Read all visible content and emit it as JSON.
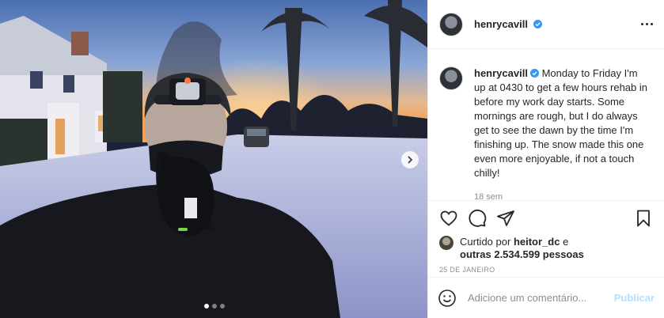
{
  "post": {
    "username": "henrycavill",
    "caption_text": "Monday to Friday I'm up at 0430 to get a few hours rehab in before my work day starts. Some mornings are rough, but I do always get to see the dawn by the time I'm finishing up. The snow made this one even more enjoyable, if not a touch chilly!",
    "caption_age": "18 sem",
    "liked_by_prefix": "Curtido por",
    "liked_by_user": "heitor_dc",
    "liked_by_and": "e",
    "liked_by_others": "outras 2.534.599 pessoas",
    "date": "25 DE JANEIRO",
    "carousel_total": 3,
    "carousel_active": 1
  },
  "comment": {
    "placeholder": "Adicione um comentário...",
    "publish_label": "Publicar"
  },
  "colors": {
    "verified": "#3897f0",
    "publish_disabled": "#b2dffc",
    "meta_gray": "#8e8e8e"
  },
  "icons": [
    "verified-badge-icon",
    "more-options-icon",
    "heart-icon",
    "comment-icon",
    "share-icon",
    "save-icon",
    "emoji-icon",
    "chevron-right-icon"
  ]
}
